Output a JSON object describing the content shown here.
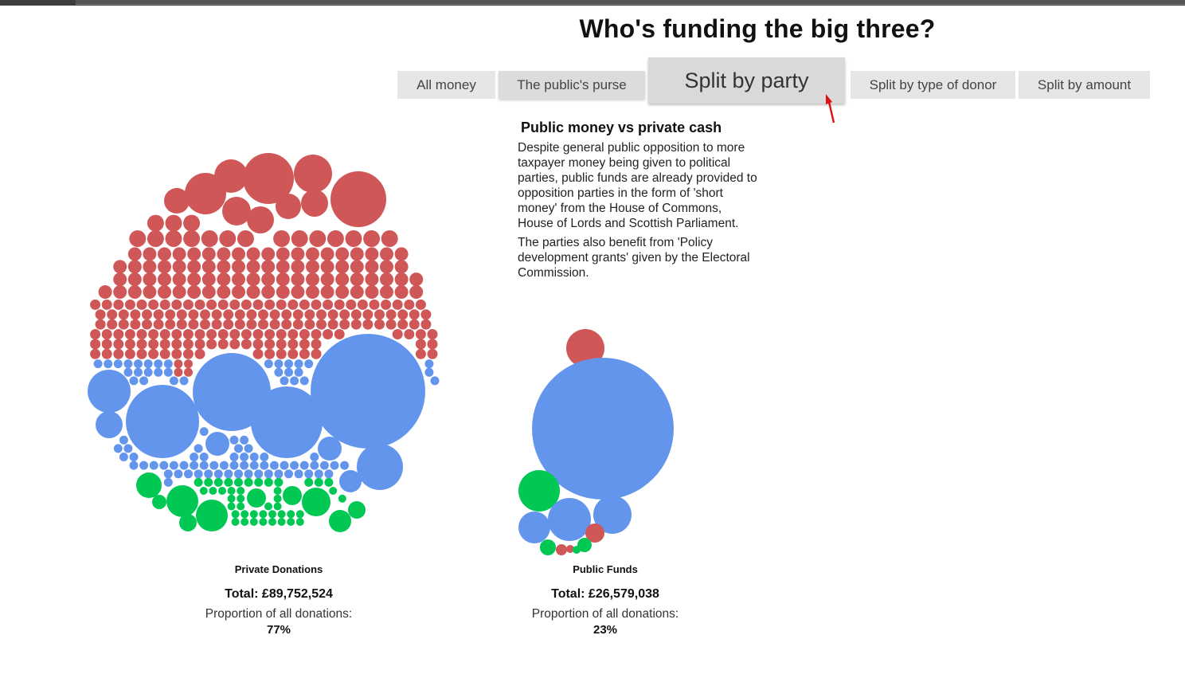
{
  "title": "Who's funding the big three?",
  "tabs": [
    {
      "label": "All money",
      "active": false
    },
    {
      "label": "The public's purse",
      "active": false
    },
    {
      "label": "Split by party",
      "active": true
    },
    {
      "label": "Split by type of donor",
      "active": false
    },
    {
      "label": "Split by amount",
      "active": false
    }
  ],
  "info": {
    "heading": "Public money vs private cash",
    "para1": "Despite general public opposition to more taxpayer money being given to political parties, public funds are already provided to opposition parties in the form of 'short money' from the House of Commons, House of Lords and Scottish Parliament.",
    "para2": "The parties also benefit from 'Policy development grants' given by the Electoral Commission."
  },
  "colors": {
    "party_red": "#d05757",
    "party_blue": "#6495ed",
    "party_green": "#00c853"
  },
  "chart_data": {
    "type": "bubble-pack",
    "groups": [
      {
        "name": "Private Donations",
        "total": "Total: £89,752,524",
        "proportion_label": "Proportion of all donations:",
        "proportion": "77%"
      },
      {
        "name": "Public Funds",
        "total": "Total: £26,579,038",
        "proportion_label": "Proportion of all donations:",
        "proportion": "23%"
      }
    ]
  }
}
